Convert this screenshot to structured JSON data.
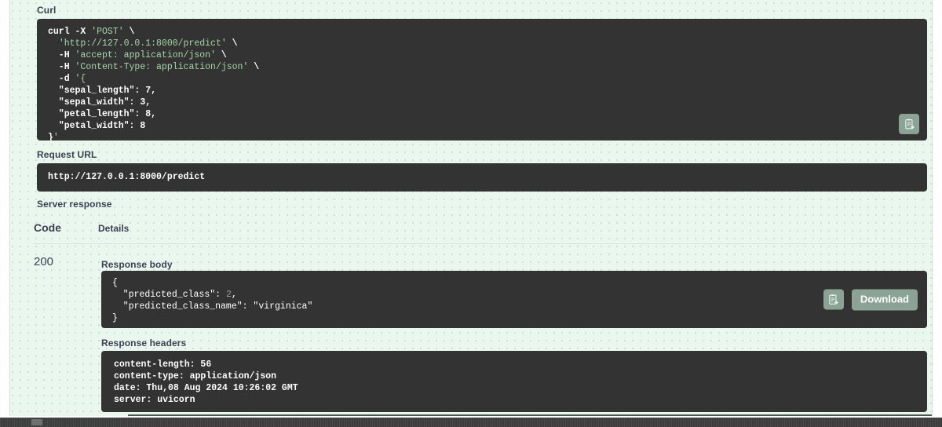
{
  "labels": {
    "curl": "Curl",
    "request_url": "Request URL",
    "server_response": "Server response",
    "response_body": "Response body",
    "response_headers": "Response headers"
  },
  "table": {
    "col_code": "Code",
    "col_details": "Details",
    "status_code": "200"
  },
  "curl": {
    "lines": [
      "curl -X 'POST' \\",
      "  'http://127.0.0.1:8000/predict' \\",
      "  -H 'accept: application/json' \\",
      "  -H 'Content-Type: application/json' \\",
      "  -d '{",
      "  \"sepal_length\": 7,",
      "  \"sepal_width\": 3,",
      "  \"petal_length\": 8,",
      "  \"petal_width\": 8",
      "}'"
    ]
  },
  "request_url": {
    "value": "http://127.0.0.1:8000/predict"
  },
  "response_body": {
    "lines": [
      "{",
      "  \"predicted_class\": 2,",
      "  \"predicted_class_name\": \"virginica\"",
      "}"
    ],
    "predicted_class": 2,
    "predicted_class_name": "virginica"
  },
  "response_headers": {
    "lines": [
      "content-length: 56",
      "content-type: application/json",
      "date: Thu,08 Aug 2024 10:26:02 GMT",
      "server: uvicorn"
    ],
    "content_length": "56",
    "content_type": "application/json",
    "date": "Thu,08 Aug 2024 10:26:02 GMT",
    "server": "uvicorn"
  },
  "buttons": {
    "download": "Download",
    "copy_icon": "copy-to-clipboard-icon"
  },
  "colors": {
    "page_background": "#eaf7ef",
    "code_background": "#333333",
    "button": "#8ba394",
    "text": "#3b4151",
    "string_token": "#a5d6a7"
  }
}
